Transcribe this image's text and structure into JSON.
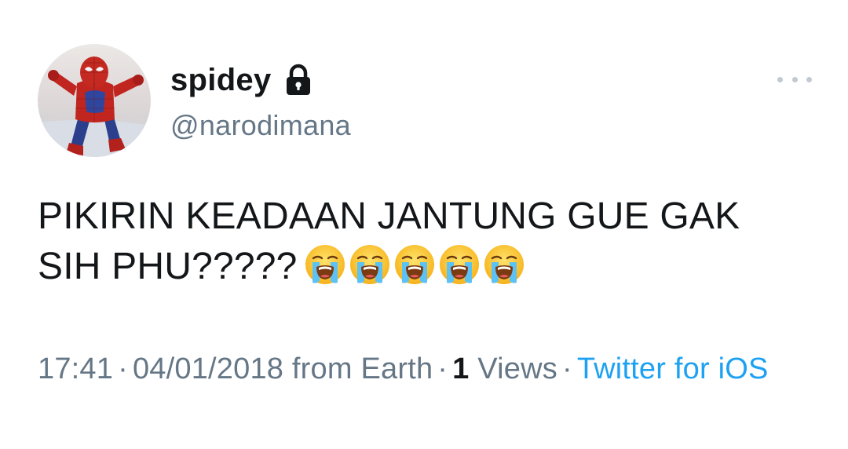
{
  "author": {
    "display_name": "spidey",
    "handle": "@narodimana",
    "avatar_icon": "spiderman-avatar",
    "lock_icon": "lock-icon"
  },
  "more_icon": "more-horizontal-icon",
  "tweet": {
    "text_line1": "PIKIRIN KEADAAN JANTUNG GUE GAK",
    "text_line2": "SIH PHU?????",
    "emoji_name": "loudly-crying-face-emoji",
    "emoji_count": 5
  },
  "meta": {
    "time": "17:41",
    "separator": "·",
    "date": "04/01/2018",
    "location": "from Earth",
    "views_count": "1",
    "views_label": "Views",
    "source": "Twitter for iOS"
  },
  "colors": {
    "text_primary": "#14171a",
    "text_secondary": "#657786",
    "link": "#1da1f2",
    "more_dots": "#c2c9d0"
  }
}
